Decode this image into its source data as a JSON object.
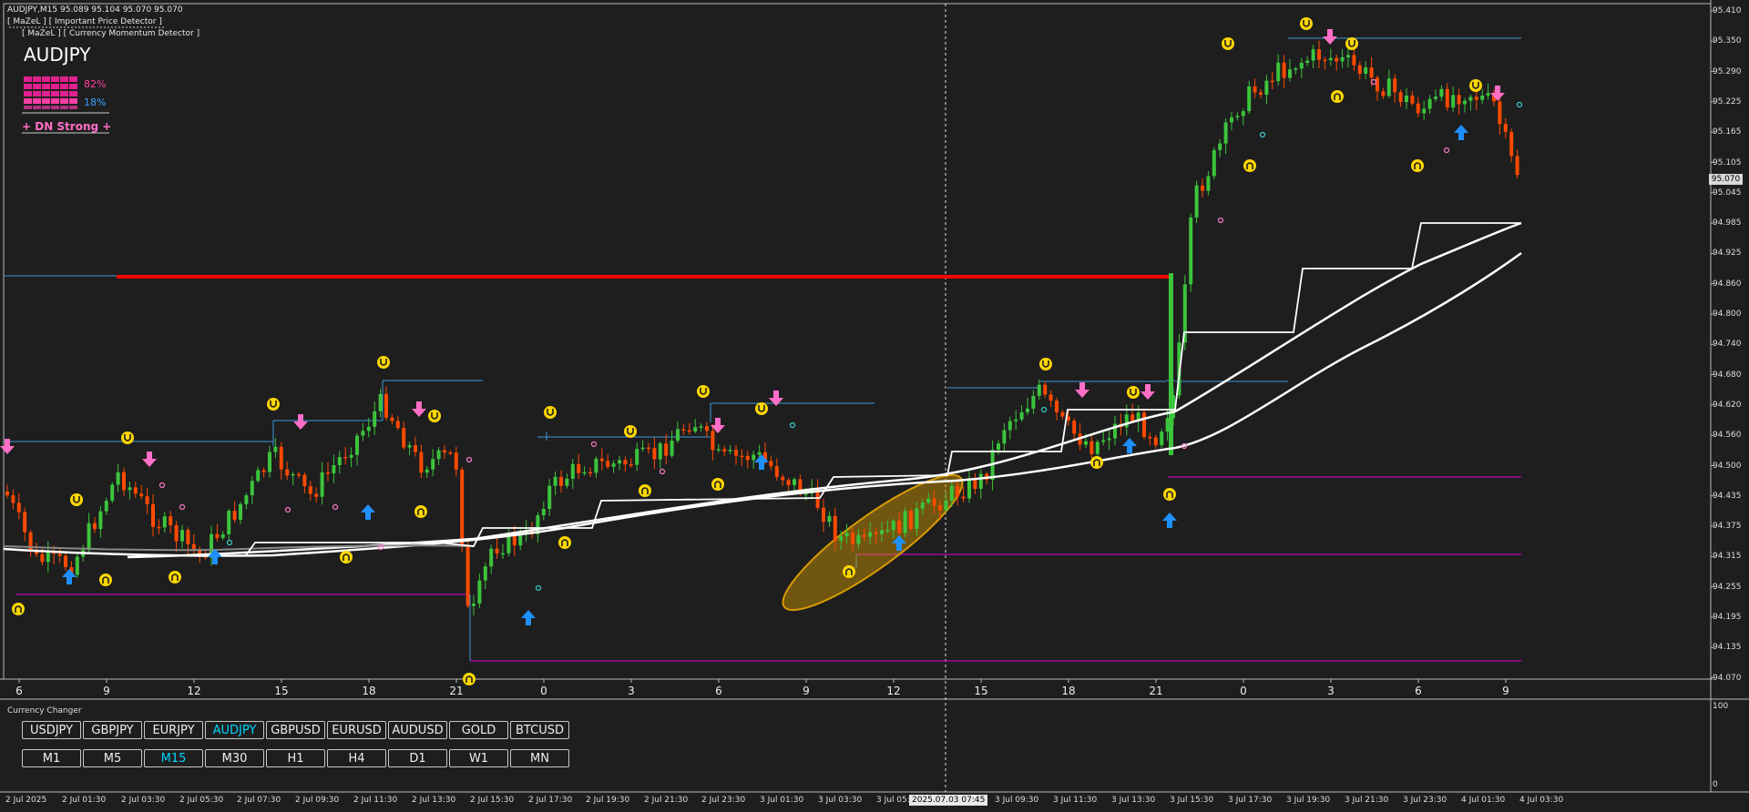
{
  "header": {
    "symbol_line": "AUDJPY,M15  95.089 95.104 95.070 95.070",
    "indicator1": "[ MaZeL ] [ Important Price Detector ]",
    "indicator2": "[ MaZeL ] [ Currency Momentum Detector ]"
  },
  "momentum": {
    "symbol": "AUDJPY",
    "pct_down": "82%",
    "pct_up": "18%",
    "status": "+ DN Strong +"
  },
  "price_axis": {
    "labels": [
      "95.410",
      "95.350",
      "95.290",
      "95.225",
      "95.165",
      "95.105",
      "95.045",
      "94.985",
      "94.925",
      "94.860",
      "94.800",
      "94.740",
      "94.680",
      "94.620",
      "94.560",
      "94.500",
      "94.435",
      "94.375",
      "94.315",
      "94.255",
      "94.195",
      "94.135",
      "94.070"
    ],
    "current_price": "95.070"
  },
  "hour_axis": [
    "6",
    "9",
    "12",
    "15",
    "18",
    "21",
    "0",
    "3",
    "6",
    "9",
    "12",
    "15",
    "18",
    "21",
    "0",
    "3",
    "6",
    "9"
  ],
  "time_axis": [
    "2 Jul 2025",
    "2 Jul 01:30",
    "2 Jul 03:30",
    "2 Jul 05:30",
    "2 Jul 07:30",
    "2 Jul 09:30",
    "2 Jul 11:30",
    "2 Jul 13:30",
    "2 Jul 15:30",
    "2 Jul 17:30",
    "2 Jul 19:30",
    "2 Jul 21:30",
    "2 Jul 23:30",
    "3 Jul 01:30",
    "3 Jul 03:30",
    "3 Jul 05:30",
    "3 Jul 09:30",
    "3 Jul 11:30",
    "3 Jul 13:30",
    "3 Jul 15:30",
    "3 Jul 17:30",
    "3 Jul 19:30",
    "3 Jul 21:30",
    "3 Jul 23:30",
    "4 Jul 01:30",
    "4 Jul 03:30"
  ],
  "crosshair_time": "2025.07.03 07:45",
  "subwindow": {
    "title": "Currency Changer",
    "axis_top": "100",
    "axis_bottom": "0",
    "symbols": [
      "USDJPY",
      "GBPJPY",
      "EURJPY",
      "AUDJPY",
      "GBPUSD",
      "EURUSD",
      "AUDUSD",
      "GOLD",
      "BTCUSD"
    ],
    "active_symbol": "AUDJPY",
    "timeframes": [
      "M1",
      "M5",
      "M15",
      "M30",
      "H1",
      "H4",
      "D1",
      "W1",
      "MN"
    ],
    "active_timeframe": "M15"
  },
  "colors": {
    "background": "#1e1e1e",
    "bull": "#3cc43c",
    "bear": "#ff4a00",
    "red_level": "#ff0000",
    "blue_level": "#3a9ad9",
    "magenta_level": "#c000c0",
    "moving_avg": "#ffffff",
    "signal_yellow": "#ffd700",
    "arrow_up": "#1e90ff",
    "arrow_down": "#ff6ec7",
    "ellipse": "#d89b00"
  }
}
